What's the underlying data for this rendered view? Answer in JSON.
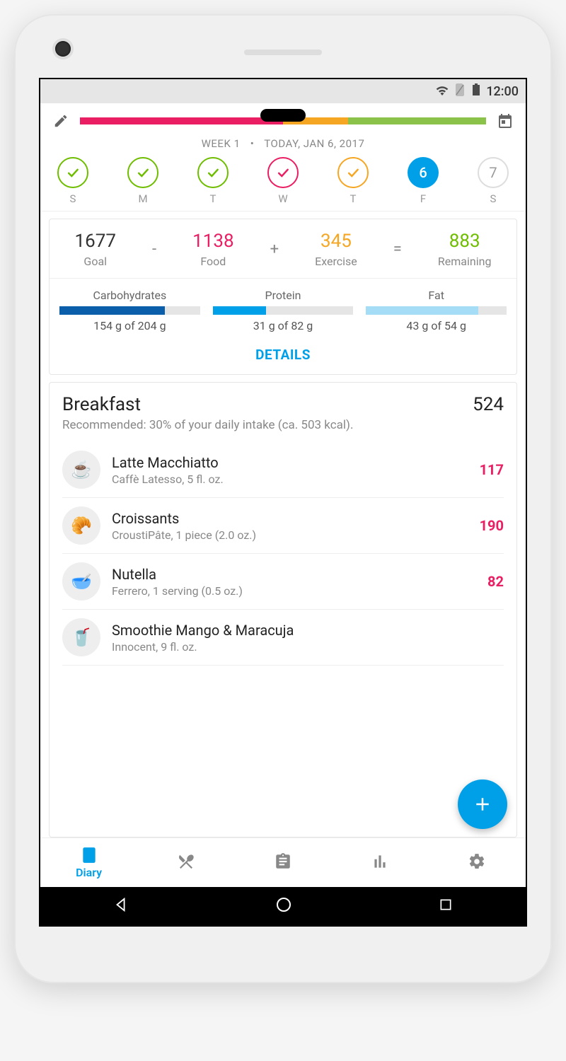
{
  "status": {
    "time": "12:00"
  },
  "header": {
    "week_label": "WEEK 1",
    "date_label": "TODAY, JAN 6, 2017",
    "progress": [
      {
        "color": "#e91e63",
        "pct": 50
      },
      {
        "color": "#f5a623",
        "pct": 16
      },
      {
        "color": "#8bc34a",
        "pct": 34
      }
    ],
    "days": [
      {
        "label": "S",
        "state": "check-green"
      },
      {
        "label": "M",
        "state": "check-green"
      },
      {
        "label": "T",
        "state": "check-green"
      },
      {
        "label": "W",
        "state": "check-pink"
      },
      {
        "label": "T",
        "state": "check-amber"
      },
      {
        "label": "F",
        "state": "current",
        "num": "6"
      },
      {
        "label": "S",
        "state": "future",
        "num": "7"
      }
    ]
  },
  "summary": {
    "goal": {
      "value": "1677",
      "label": "Goal"
    },
    "food": {
      "value": "1138",
      "label": "Food"
    },
    "exercise": {
      "value": "345",
      "label": "Exercise"
    },
    "remaining": {
      "value": "883",
      "label": "Remaining"
    },
    "ops": {
      "minus": "-",
      "plus": "+",
      "equals": "="
    },
    "macros": [
      {
        "name": "Carbohydrates",
        "text": "154 g of 204 g",
        "pct": 75,
        "color": "#0b5faa"
      },
      {
        "name": "Protein",
        "text": "31 g of 82 g",
        "pct": 38,
        "color": "#00a0e9"
      },
      {
        "name": "Fat",
        "text": "43 g of 54 g",
        "pct": 80,
        "color": "#a5ddf7"
      }
    ],
    "details": "DETAILS"
  },
  "meal": {
    "title": "Breakfast",
    "total": "524",
    "reco": "Recommended: 30% of your daily intake (ca. 503 kcal).",
    "items": [
      {
        "name": "Latte Macchiatto",
        "desc": "Caffè Latesso, 5 fl. oz.",
        "cal": "117",
        "emoji": "☕"
      },
      {
        "name": "Croissants",
        "desc": "CroustiPâte, 1 piece (2.0 oz.)",
        "cal": "190",
        "emoji": "🥐"
      },
      {
        "name": "Nutella",
        "desc": "Ferrero, 1 serving (0.5 oz.)",
        "cal": "82",
        "emoji": "🥣"
      },
      {
        "name": "Smoothie Mango & Maracuja",
        "desc": "Innocent, 9 fl. oz.",
        "cal": "",
        "emoji": "🥤"
      }
    ]
  },
  "tabs": {
    "diary": "Diary"
  }
}
